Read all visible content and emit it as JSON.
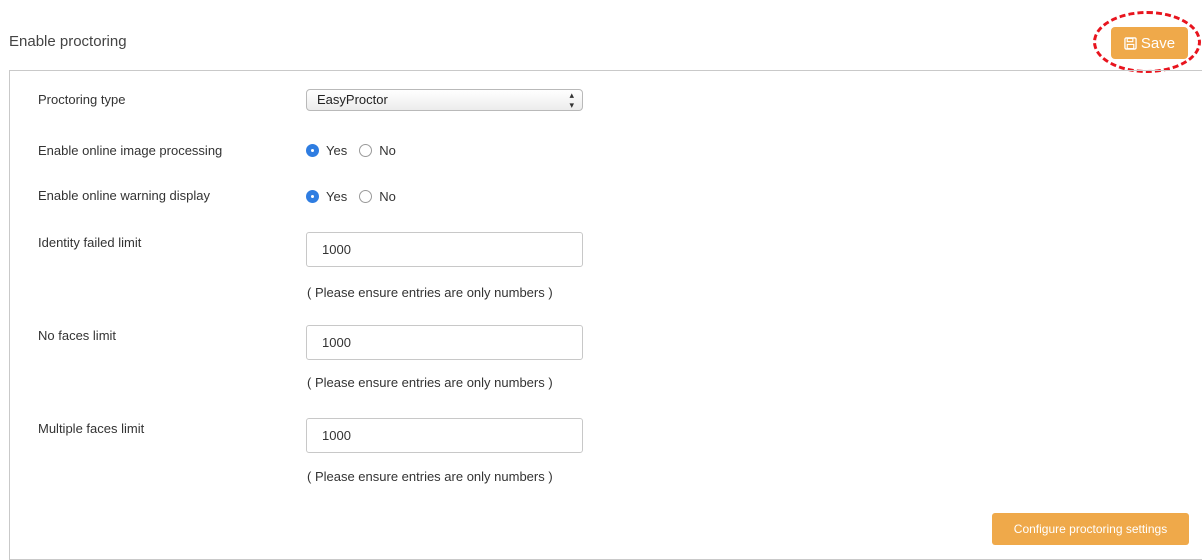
{
  "header": {
    "title": "Enable proctoring",
    "save_label": "Save",
    "save_icon": "floppy-disk-icon",
    "accent_color": "#efa94a",
    "highlight_color": "#e8141e"
  },
  "form": {
    "proctoring_type": {
      "label": "Proctoring type",
      "selected": "EasyProctor"
    },
    "image_processing": {
      "label": "Enable online image processing",
      "options": [
        "Yes",
        "No"
      ],
      "selected": "Yes"
    },
    "warning_display": {
      "label": "Enable online warning display",
      "options": [
        "Yes",
        "No"
      ],
      "selected": "Yes"
    },
    "identity_failed_limit": {
      "label": "Identity failed limit",
      "value": "1000",
      "hint": "( Please ensure entries are only numbers )"
    },
    "no_faces_limit": {
      "label": "No faces limit",
      "value": "1000",
      "hint": "( Please ensure entries are only numbers )"
    },
    "multiple_faces_limit": {
      "label": "Multiple faces limit",
      "value": "1000",
      "hint": "( Please ensure entries are only numbers )"
    }
  },
  "footer": {
    "configure_label": "Configure proctoring settings"
  }
}
